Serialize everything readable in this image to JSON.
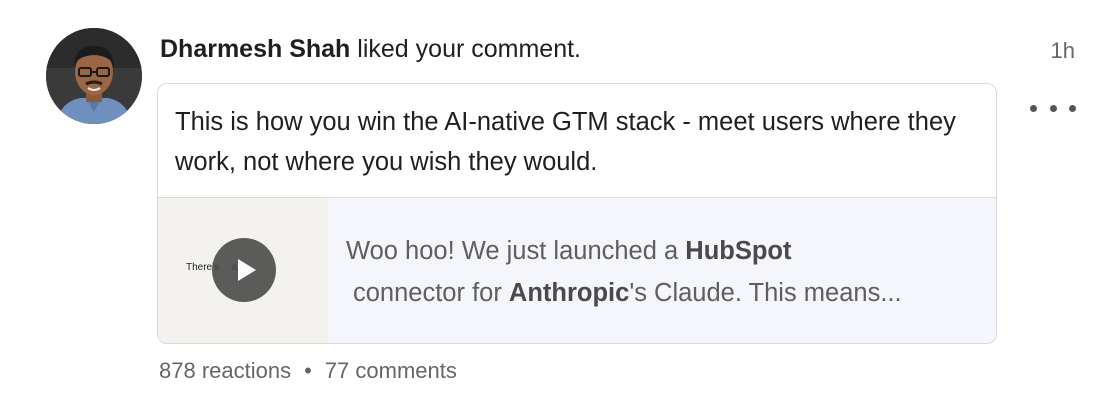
{
  "notification": {
    "actor_name": "Dharmesh Shah",
    "action_text": "liked your comment.",
    "timestamp": "1h",
    "more_icon": "ellipsis-horizontal-icon"
  },
  "comment": {
    "text": "This is how you win the AI-native GTM stack - meet users where they work, not where you wish they would."
  },
  "shared_post": {
    "thumbnail_caption": "There's a",
    "play_icon": "play-icon",
    "preview_part1": "Woo hoo! We just launched a ",
    "preview_bold1": "HubSpot",
    "preview_part2": "connector for ",
    "preview_bold2": "Anthropic",
    "preview_part3": "'s Claude. This means..."
  },
  "stats": {
    "reactions": "878 reactions",
    "separator": "•",
    "comments": "77 comments"
  },
  "colors": {
    "text_primary": "#1f1f1f",
    "text_secondary": "#666666",
    "card_border": "#d9d9d9",
    "preview_bg": "#f4f6fb",
    "thumbnail_bg": "#f4f2ee"
  }
}
